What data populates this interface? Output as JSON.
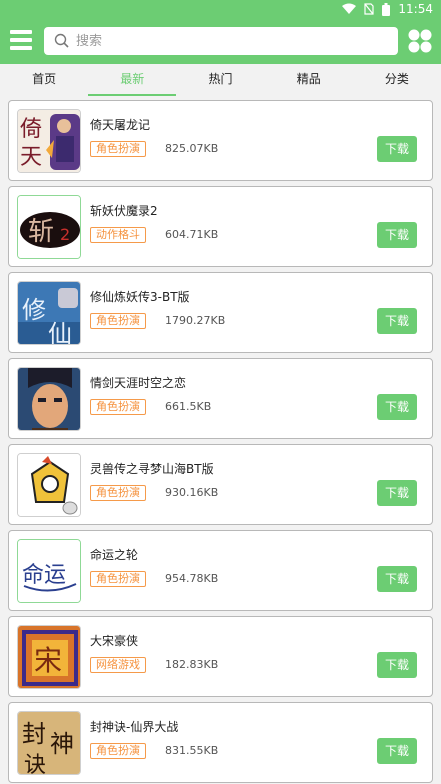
{
  "status": {
    "time": "11:54"
  },
  "search": {
    "placeholder": "搜索"
  },
  "tabs": [
    "首页",
    "最新",
    "热门",
    "精品",
    "分类"
  ],
  "colors": {
    "brand": "#6ccd73",
    "tag": "#f5923e",
    "download_bg": "#6ccd73"
  },
  "games": [
    {
      "name": "倚天屠龙记",
      "tag": "角色扮演",
      "size": "825.07KB",
      "download": "下载",
      "icon": "yitian-icon"
    },
    {
      "name": "斩妖伏魔录2",
      "tag": "动作格斗",
      "size": "604.71KB",
      "download": "下载",
      "icon": "zhanyao-icon"
    },
    {
      "name": "修仙炼妖传3-BT版",
      "tag": "角色扮演",
      "size": "1790.27KB",
      "download": "下载",
      "icon": "xiuxian-icon"
    },
    {
      "name": "情剑天涯时空之恋",
      "tag": "角色扮演",
      "size": "661.5KB",
      "download": "下载",
      "icon": "qingjian-icon"
    },
    {
      "name": "灵兽传之寻梦山海BT版",
      "tag": "角色扮演",
      "size": "930.16KB",
      "download": "下载",
      "icon": "lingshou-icon"
    },
    {
      "name": "命运之轮",
      "tag": "角色扮演",
      "size": "954.78KB",
      "download": "下载",
      "icon": "mingyun-icon"
    },
    {
      "name": "大宋豪侠",
      "tag": "网络游戏",
      "size": "182.83KB",
      "download": "下载",
      "icon": "dasong-icon"
    },
    {
      "name": "封神诀-仙界大战",
      "tag": "角色扮演",
      "size": "831.55KB",
      "download": "下载",
      "icon": "fengshen-icon"
    }
  ]
}
